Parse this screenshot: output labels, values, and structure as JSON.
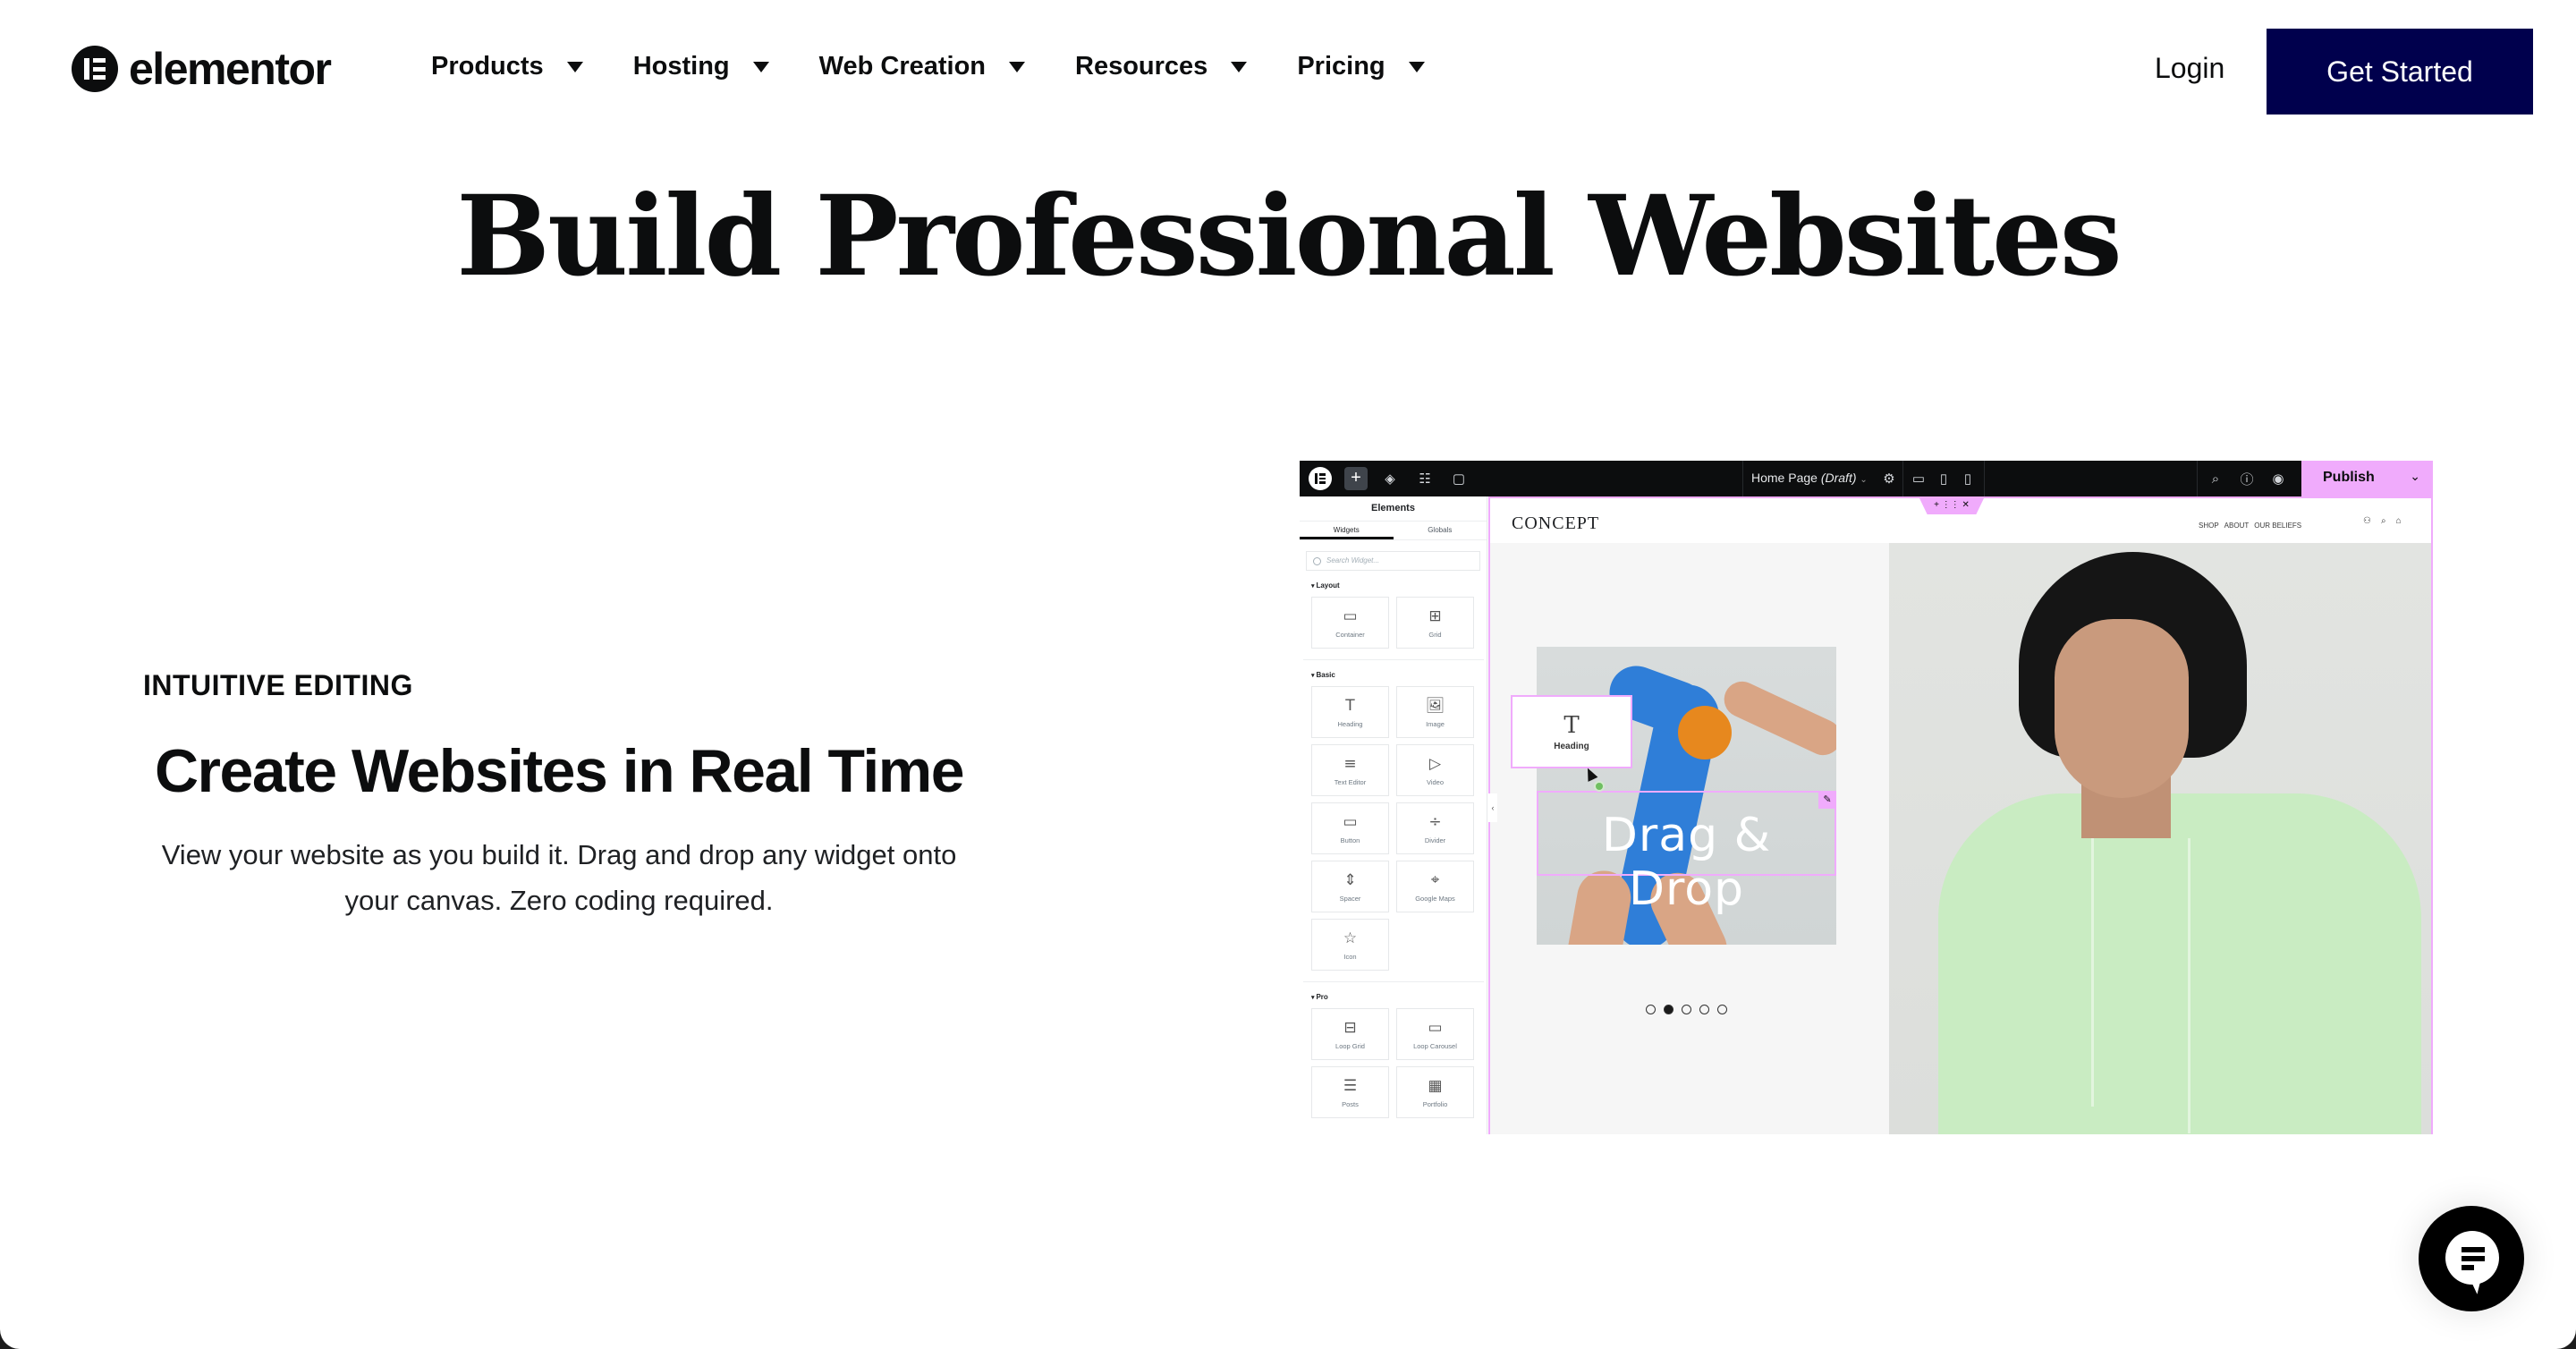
{
  "nav": {
    "brand": "elementor",
    "menu": [
      {
        "label": "Products"
      },
      {
        "label": "Hosting"
      },
      {
        "label": "Web Creation"
      },
      {
        "label": "Resources"
      },
      {
        "label": "Pricing"
      }
    ],
    "login_label": "Login",
    "cta_label": "Get Started",
    "cta_color": "#00004d"
  },
  "hero": {
    "title": "Build Professional Websites"
  },
  "feature": {
    "eyebrow": "INTUITIVE EDITING",
    "title": "Create Websites in Real Time",
    "description": "View your website as you build it. Drag and drop any widget onto your canvas. Zero coding required."
  },
  "editor": {
    "accent_color": "#f0abfc",
    "top_bar": {
      "page_name": "Home Page",
      "page_status": "(Draft)",
      "publish_label": "Publish"
    },
    "panel": {
      "title": "Elements",
      "tabs": [
        {
          "label": "Widgets",
          "active": true
        },
        {
          "label": "Globals",
          "active": false
        }
      ],
      "search_placeholder": "Search Widget...",
      "categories": [
        {
          "name": "Layout",
          "widgets": [
            {
              "label": "Container",
              "icon": "container-icon",
              "glyph": "▭"
            },
            {
              "label": "Grid",
              "icon": "grid-icon",
              "glyph": "⊞"
            }
          ]
        },
        {
          "name": "Basic",
          "widgets": [
            {
              "label": "Heading",
              "icon": "heading-icon",
              "glyph": "T"
            },
            {
              "label": "Image",
              "icon": "image-icon",
              "glyph": "🖼"
            },
            {
              "label": "Text Editor",
              "icon": "text-editor-icon",
              "glyph": "≡"
            },
            {
              "label": "Video",
              "icon": "video-icon",
              "glyph": "▷"
            },
            {
              "label": "Button",
              "icon": "button-icon",
              "glyph": "▭"
            },
            {
              "label": "Divider",
              "icon": "divider-icon",
              "glyph": "÷"
            },
            {
              "label": "Spacer",
              "icon": "spacer-icon",
              "glyph": "⇕"
            },
            {
              "label": "Google Maps",
              "icon": "google-maps-icon",
              "glyph": "⌖"
            },
            {
              "label": "Icon",
              "icon": "star-icon",
              "glyph": "☆"
            }
          ]
        },
        {
          "name": "Pro",
          "widgets": [
            {
              "label": "Loop Grid",
              "icon": "loop-grid-icon",
              "glyph": "⊟"
            },
            {
              "label": "Loop Carousel",
              "icon": "loop-carousel-icon",
              "glyph": "▭"
            },
            {
              "label": "Posts",
              "icon": "posts-icon",
              "glyph": "☰"
            },
            {
              "label": "Portfolio",
              "icon": "portfolio-icon",
              "glyph": "▦"
            }
          ]
        }
      ]
    },
    "canvas": {
      "site_logo": "CONCEPT",
      "site_links": [
        "SHOP",
        "ABOUT",
        "OUR BELIEFS"
      ],
      "dragged_widget_label": "Heading",
      "headline": "Drag & Drop",
      "carousel_active_index": 1,
      "carousel_count": 5
    }
  }
}
